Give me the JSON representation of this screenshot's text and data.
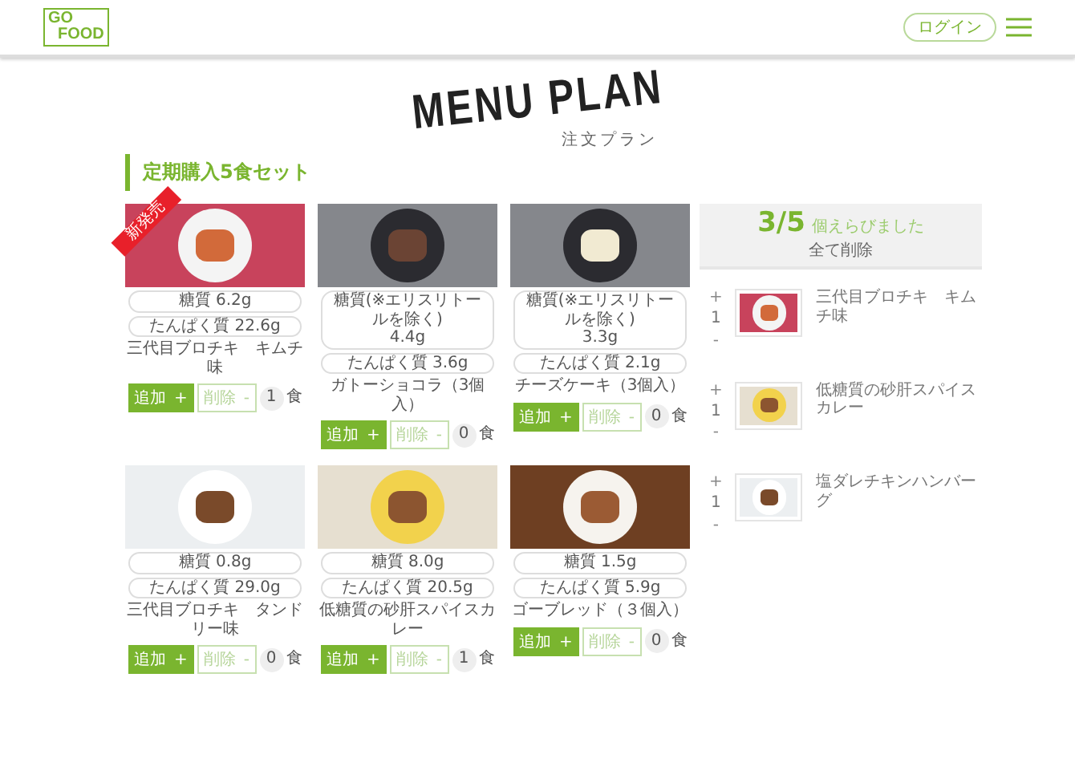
{
  "header": {
    "logo": {
      "line_1": "GO",
      "line_2": "FOOD"
    },
    "login_button": "ログイン"
  },
  "title": "MENU PLAN",
  "subtitle": "注文プラン",
  "section_heading": "定期購入5食セット",
  "products": [
    {
      "name": "三代目ブロチキ　キムチ味",
      "badge": "新発売",
      "nutrition": [
        [
          "糖質 6.2g"
        ],
        [
          "たんぱく質 22.6g"
        ]
      ],
      "add_label": "追加",
      "add_icon": "+",
      "remove_label": "削除",
      "remove_icon": "-",
      "count": "1",
      "count_unit": "食"
    },
    {
      "name": "ガトーショコラ（3個入）",
      "nutrition": [
        [
          "糖質(※エリスリトールを除く)",
          "4.4g"
        ],
        [
          "たんぱく質 3.6g"
        ]
      ],
      "add_label": "追加",
      "add_icon": "+",
      "remove_label": "削除",
      "remove_icon": "-",
      "count": "0",
      "count_unit": "食"
    },
    {
      "name": "チーズケーキ（3個入）",
      "nutrition": [
        [
          "糖質(※エリスリトールを除く)",
          "3.3g"
        ],
        [
          "たんぱく質 2.1g"
        ]
      ],
      "add_label": "追加",
      "add_icon": "+",
      "remove_label": "削除",
      "remove_icon": "-",
      "count": "0",
      "count_unit": "食"
    },
    {
      "name": "三代目ブロチキ　タンドリー味",
      "nutrition": [
        [
          "糖質 0.8g"
        ],
        [
          "たんぱく質 29.0g"
        ]
      ],
      "add_label": "追加",
      "add_icon": "+",
      "remove_label": "削除",
      "remove_icon": "-",
      "count": "0",
      "count_unit": "食"
    },
    {
      "name": "低糖質の砂肝スパイスカレー",
      "nutrition": [
        [
          "糖質 8.0g"
        ],
        [
          "たんぱく質 20.5g"
        ]
      ],
      "add_label": "追加",
      "add_icon": "+",
      "remove_label": "削除",
      "remove_icon": "-",
      "count": "1",
      "count_unit": "食"
    },
    {
      "name": "ゴーブレッド（３個入）",
      "nutrition": [
        [
          "糖質 1.5g"
        ],
        [
          "たんぱく質 5.9g"
        ]
      ],
      "add_label": "追加",
      "add_icon": "+",
      "remove_label": "削除",
      "remove_icon": "-",
      "count": "0",
      "count_unit": "食"
    }
  ],
  "cart": {
    "count": "3/5",
    "count_caption": "個えらびました",
    "clear_all": "全て削除",
    "items": [
      {
        "name": "三代目ブロチキ　キムチ味",
        "increment": "+",
        "quantity": "1",
        "decrement": "-"
      },
      {
        "name": "低糖質の砂肝スパイスカレー",
        "increment": "+",
        "quantity": "1",
        "decrement": "-"
      },
      {
        "name": "塩ダレチキンハンバーグ",
        "increment": "+",
        "quantity": "1",
        "decrement": "-"
      }
    ]
  }
}
